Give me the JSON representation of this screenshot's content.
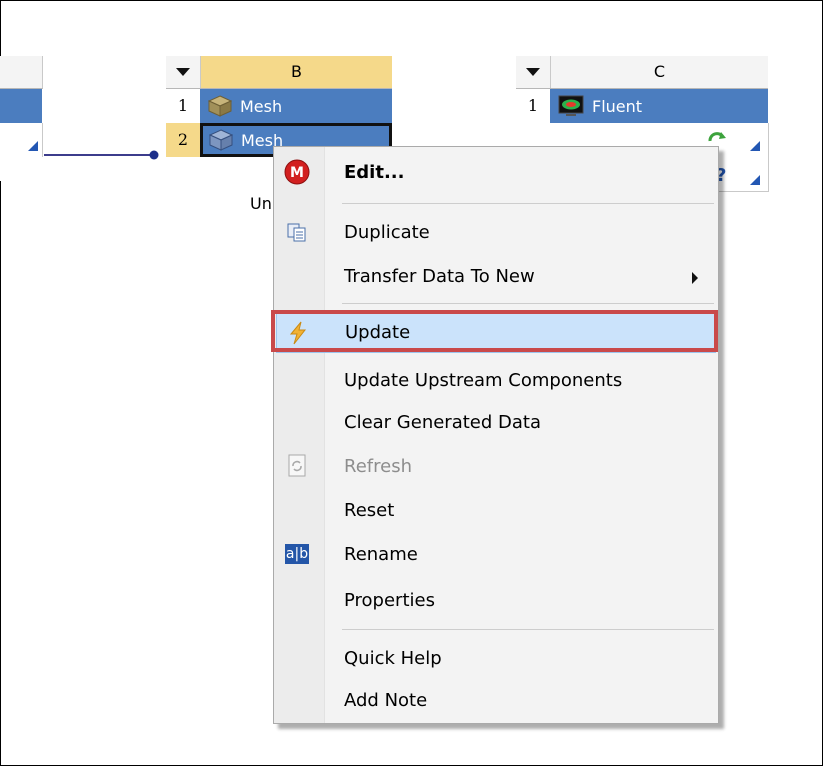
{
  "systems": {
    "a": {
      "visible": true
    },
    "b": {
      "column_letter": "B",
      "rows": [
        {
          "num": "1",
          "label": "Mesh"
        },
        {
          "num": "2",
          "label": "Mesh"
        }
      ],
      "caption": "Unit"
    },
    "c": {
      "column_letter": "C",
      "rows": [
        {
          "num": "1",
          "label": "Fluent"
        }
      ]
    }
  },
  "context_menu": {
    "items": [
      {
        "label": "Edit...",
        "icon": "mesh-app-icon",
        "bold": true
      },
      {
        "label": "Duplicate",
        "icon": "duplicate-icon"
      },
      {
        "label": "Transfer Data To New",
        "icon": "",
        "submenu": true
      },
      {
        "label": "Update",
        "icon": "lightning-icon",
        "highlighted": true
      },
      {
        "label": "Update Upstream Components",
        "icon": ""
      },
      {
        "label": "Clear Generated Data",
        "icon": ""
      },
      {
        "label": "Refresh",
        "icon": "refresh-icon",
        "disabled": true
      },
      {
        "label": "Reset",
        "icon": ""
      },
      {
        "label": "Rename",
        "icon": "rename-icon"
      },
      {
        "label": "Properties",
        "icon": ""
      },
      {
        "label": "Quick Help",
        "icon": ""
      },
      {
        "label": "Add Note",
        "icon": ""
      }
    ]
  },
  "colors": {
    "header_yellow": "#f5d98a",
    "row_blue": "#4b7dbf",
    "highlight": "#cbe3fb",
    "annotation_red": "#c9494a"
  }
}
